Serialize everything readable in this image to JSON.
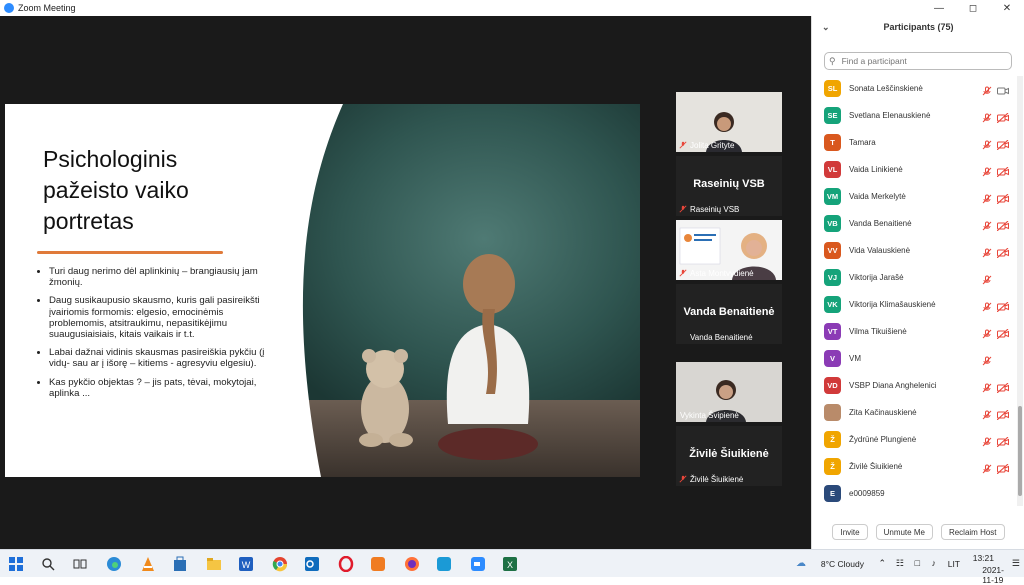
{
  "window": {
    "title": "Zoom Meeting"
  },
  "slide": {
    "title_lines": [
      "Psichologinis",
      "pažeisto vaiko",
      "portretas"
    ],
    "bullets": [
      "Turi daug nerimo dėl aplinkinių – brangiausių jam žmonių.",
      "Daug susikaupusio skausmo, kuris gali pasireikšti įvairiomis formomis: elgesio, emocinėmis problemomis, atsitraukimu, nepasitikėjimu suaugusiaisiais, kitais vaikais ir t.t.",
      "Labai dažnai vidinis skausmas pasireiškia pykčiu (į vidų- sau ar į išorę – kitiems - agresyviu elgesiu).",
      "Kas pykčio objektas ? – jis pats, tėvai, mokytojai, aplinka ..."
    ],
    "accent": "#e07a3a"
  },
  "tiles": [
    {
      "name": "Jolita Grityte",
      "type": "video"
    },
    {
      "name": "Raseinių VSB",
      "big": "Raseinių VSB",
      "type": "name"
    },
    {
      "name": "Asta Montvydienė",
      "type": "video"
    },
    {
      "name": "Vanda Benaitienė",
      "big": "Vanda Benaitienė",
      "type": "name"
    },
    {
      "name": "Vykinta Švipienė",
      "type": "video",
      "active": true
    },
    {
      "name": "Živilė Šiuikienė",
      "big": "Živilė Šiuikienė",
      "type": "name"
    }
  ],
  "participants_panel": {
    "title": "Participants (75)",
    "search_placeholder": "Find a participant",
    "participants": [
      {
        "initials": "SL",
        "name": "Sonata Leščinskienė",
        "color": "#f0a500",
        "video": true
      },
      {
        "initials": "SE",
        "name": "Svetlana Elenauskienė",
        "color": "#15a37a",
        "video": false
      },
      {
        "initials": "T",
        "name": "Tamara",
        "color": "#d9581e",
        "video": false
      },
      {
        "initials": "VL",
        "name": "Vaida Linikienė",
        "color": "#d13a3a",
        "video": false
      },
      {
        "initials": "VM",
        "name": "Vaida Merkelytė",
        "color": "#15a37a",
        "video": false
      },
      {
        "initials": "VB",
        "name": "Vanda Benaitienė",
        "color": "#15a37a",
        "video": false
      },
      {
        "initials": "VV",
        "name": "Vida Valauskienė",
        "color": "#d9581e",
        "video": false
      },
      {
        "initials": "VJ",
        "name": "Viktorija Jarašė",
        "color": "#15a37a",
        "video": null
      },
      {
        "initials": "VK",
        "name": "Viktorija Klimašauskienė",
        "color": "#15a37a",
        "video": false
      },
      {
        "initials": "VT",
        "name": "Vilma Tikuišienė",
        "color": "#8b3bb5",
        "video": false
      },
      {
        "initials": "V",
        "name": "VM",
        "color": "#8b3bb5",
        "video": null
      },
      {
        "initials": "VD",
        "name": "VSBP Diana Anghelenici",
        "color": "#d13a3a",
        "video": false
      },
      {
        "initials": "",
        "name": "Zita Kačinauskienė",
        "color": "#b98b6a",
        "video": false,
        "photo": true
      },
      {
        "initials": "Ž",
        "name": "Žydrūnė Plungienė",
        "color": "#f0a500",
        "video": false
      },
      {
        "initials": "Ž",
        "name": "Živilė Šiuikienė",
        "color": "#f0a500",
        "video": false
      },
      {
        "initials": "E",
        "name": "e0009859",
        "color": "#2b4a7a",
        "video": null,
        "nomic": true
      }
    ],
    "buttons": {
      "invite": "Invite",
      "unmute": "Unmute Me",
      "reclaim": "Reclaim Host"
    }
  },
  "taskbar": {
    "weather": "8°C  Cloudy",
    "lang": "LIT",
    "time": "13:21",
    "date": "2021-11-19"
  }
}
